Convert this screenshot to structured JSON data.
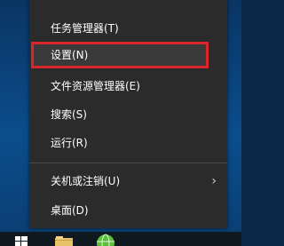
{
  "context_menu": {
    "items": [
      {
        "label": "任务管理器(T)"
      },
      {
        "label": "设置(N)"
      },
      {
        "label": "文件资源管理器(E)"
      },
      {
        "label": "搜索(S)"
      },
      {
        "label": "运行(R)"
      },
      {
        "label": "关机或注销(U)"
      },
      {
        "label": "桌面(D)"
      }
    ],
    "highlighted_index": 1,
    "submenu_chevron": "›"
  },
  "taskbar": {
    "icons": [
      "windows-start-icon",
      "folder-icon",
      "globe-icon"
    ]
  },
  "colors": {
    "menu_background": "#2b2b2b",
    "highlight_border": "#d9252b",
    "text": "#ffffff",
    "desktop": "#0b4d8c"
  }
}
